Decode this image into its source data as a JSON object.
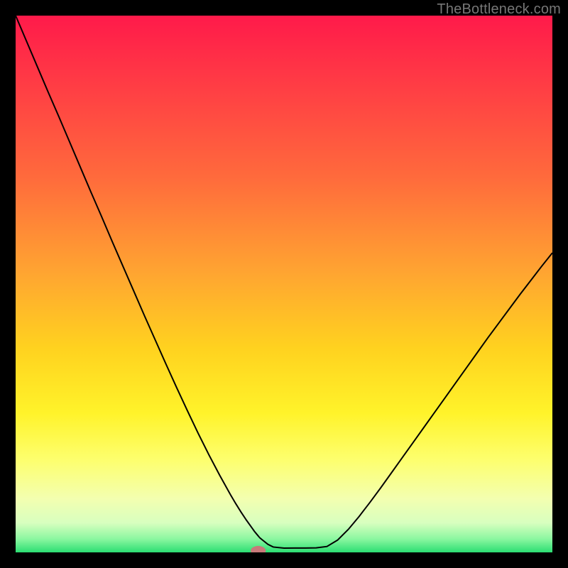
{
  "watermark": "TheBottleneck.com",
  "chart_data": {
    "type": "line",
    "title": "",
    "xlabel": "",
    "ylabel": "",
    "xlim": [
      0,
      100
    ],
    "ylim": [
      0,
      100
    ],
    "background_gradient": {
      "stops": [
        {
          "offset": 0.0,
          "color": "#ff1a4a"
        },
        {
          "offset": 0.12,
          "color": "#ff3a45"
        },
        {
          "offset": 0.3,
          "color": "#ff6a3c"
        },
        {
          "offset": 0.48,
          "color": "#ffa531"
        },
        {
          "offset": 0.62,
          "color": "#ffd21f"
        },
        {
          "offset": 0.74,
          "color": "#fff32a"
        },
        {
          "offset": 0.83,
          "color": "#fdff70"
        },
        {
          "offset": 0.9,
          "color": "#f3ffb0"
        },
        {
          "offset": 0.945,
          "color": "#d8ffbf"
        },
        {
          "offset": 0.975,
          "color": "#8bf7a0"
        },
        {
          "offset": 1.0,
          "color": "#2bde72"
        }
      ]
    },
    "series": [
      {
        "name": "bottleneck-curve",
        "color": "#000000",
        "width": 2,
        "x": [
          0,
          2,
          4,
          6,
          8,
          10,
          12,
          14,
          16,
          18,
          20,
          22,
          24,
          26,
          28,
          30,
          32,
          34,
          36,
          38,
          40,
          41,
          42,
          43,
          44,
          44.5,
          45,
          45.5,
          46,
          47,
          48,
          50,
          52,
          54,
          56,
          58,
          60,
          62,
          64,
          66,
          68,
          70,
          72,
          74,
          76,
          78,
          80,
          82,
          84,
          86,
          88,
          90,
          92,
          94,
          96,
          98,
          100
        ],
        "y": [
          100,
          95.3,
          90.6,
          85.9,
          81.3,
          76.6,
          71.9,
          67.2,
          62.6,
          57.9,
          53.3,
          48.7,
          44.1,
          39.6,
          35.1,
          30.7,
          26.4,
          22.2,
          18.2,
          14.4,
          10.8,
          9.1,
          7.5,
          6.0,
          4.6,
          3.9,
          3.3,
          2.7,
          2.3,
          1.5,
          1.0,
          0.8,
          0.81,
          0.81,
          0.84,
          1.1,
          2.3,
          4.3,
          6.7,
          9.3,
          12.0,
          14.8,
          17.6,
          20.4,
          23.2,
          26.0,
          28.8,
          31.6,
          34.4,
          37.2,
          40.0,
          42.7,
          45.4,
          48.1,
          50.7,
          53.3,
          55.8
        ]
      }
    ],
    "marker": {
      "name": "optimal-point",
      "x": 45.2,
      "y": 0.3,
      "color": "#c97a7a",
      "rx": 1.4,
      "ry": 0.9
    }
  }
}
